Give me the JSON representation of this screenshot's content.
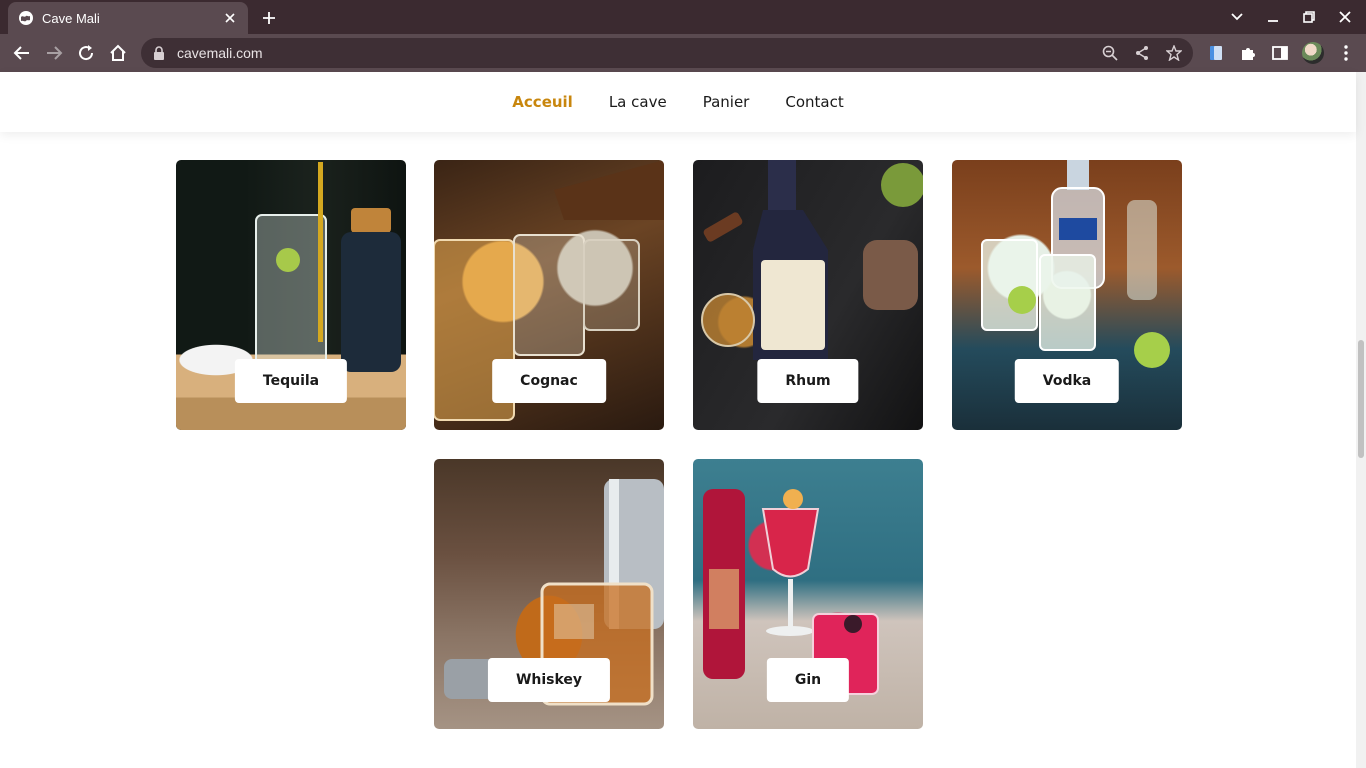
{
  "browser": {
    "tab_title": "Cave Mali",
    "url": "cavemali.com",
    "icons": {
      "favicon": "globe-icon",
      "tab_close": "close-icon",
      "new_tab": "plus-icon",
      "back": "arrow-left-icon",
      "forward": "arrow-right-icon",
      "reload": "reload-icon",
      "home": "home-icon",
      "lock": "lock-icon",
      "zoom": "zoom-icon",
      "share": "share-icon",
      "bookmark": "star-icon",
      "extension1": "extension-icon",
      "puzzle": "puzzle-icon",
      "sidepanel": "side-panel-icon",
      "menu": "kebab-menu-icon"
    }
  },
  "nav": {
    "items": [
      {
        "label": "Acceuil",
        "active": true
      },
      {
        "label": "La cave",
        "active": false
      },
      {
        "label": "Panier",
        "active": false
      },
      {
        "label": "Contact",
        "active": false
      }
    ]
  },
  "categories": [
    {
      "label": "Tequila"
    },
    {
      "label": "Cognac"
    },
    {
      "label": "Rhum"
    },
    {
      "label": "Vodka"
    },
    {
      "label": "Whiskey"
    },
    {
      "label": "Gin"
    }
  ],
  "colors": {
    "accent": "#c8860d",
    "chrome_dark": "#3b2a30",
    "chrome_tab": "#5a4a50"
  }
}
